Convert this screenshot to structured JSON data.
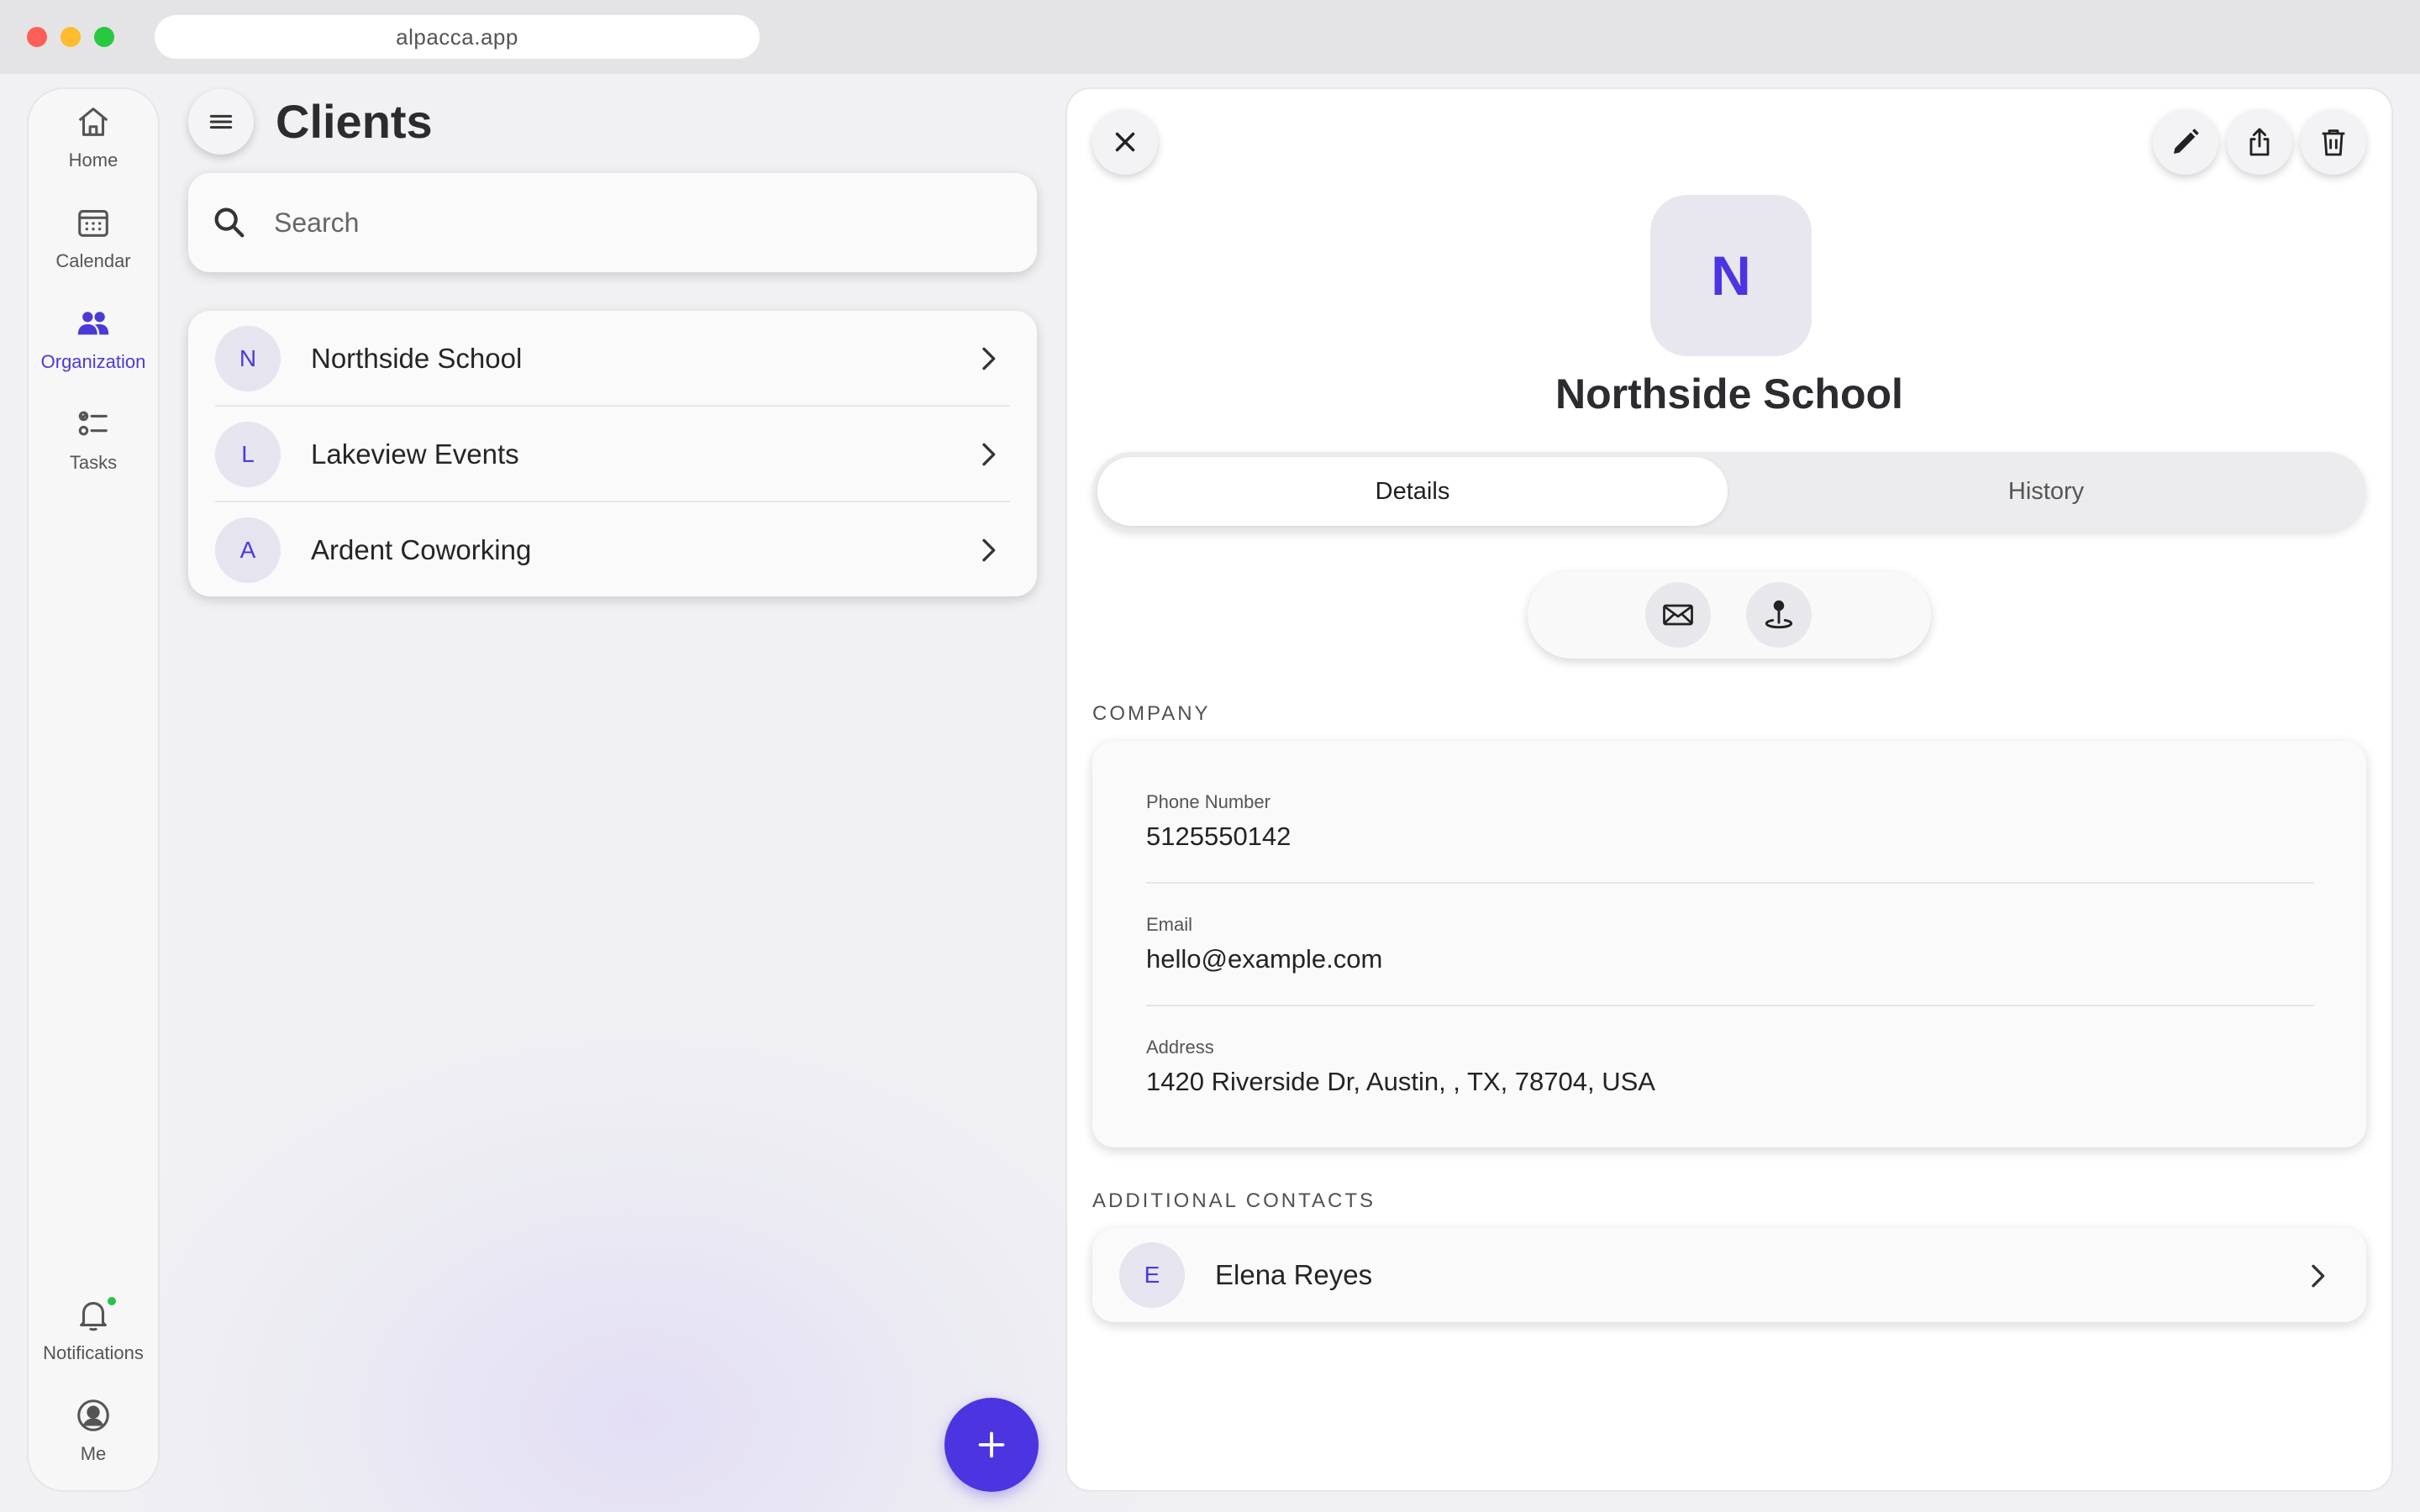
{
  "browser": {
    "url": "alpacca.app"
  },
  "rail": {
    "items": [
      {
        "label": "Home",
        "icon": "home-icon",
        "active": false
      },
      {
        "label": "Calendar",
        "icon": "calendar-icon",
        "active": false
      },
      {
        "label": "Organization",
        "icon": "people-icon",
        "active": true
      },
      {
        "label": "Tasks",
        "icon": "tasks-icon",
        "active": false
      }
    ],
    "bottom": [
      {
        "label": "Notifications",
        "icon": "bell-icon",
        "has_dot": true
      },
      {
        "label": "Me",
        "icon": "user-circle-icon"
      }
    ]
  },
  "list": {
    "title": "Clients",
    "search_placeholder": "Search",
    "clients": [
      {
        "initial": "N",
        "name": "Northside School"
      },
      {
        "initial": "L",
        "name": "Lakeview Events"
      },
      {
        "initial": "A",
        "name": "Ardent Coworking"
      }
    ]
  },
  "detail": {
    "initial": "N",
    "name": "Northside School",
    "tabs": [
      {
        "label": "Details",
        "active": true
      },
      {
        "label": "History",
        "active": false
      }
    ],
    "company_section": "COMPANY",
    "fields": [
      {
        "label": "Phone Number",
        "value": "5125550142"
      },
      {
        "label": "Email",
        "value": "hello@example.com"
      },
      {
        "label": "Address",
        "value": "1420 Riverside Dr, Austin, , TX, 78704, USA"
      }
    ],
    "contacts_section": "ADDITIONAL CONTACTS",
    "contacts": [
      {
        "initial": "E",
        "name": "Elena Reyes"
      }
    ]
  },
  "colors": {
    "accent": "#4a35e0",
    "avatar_bg": "#e6e4ef",
    "notification_dot": "#27c24c"
  }
}
